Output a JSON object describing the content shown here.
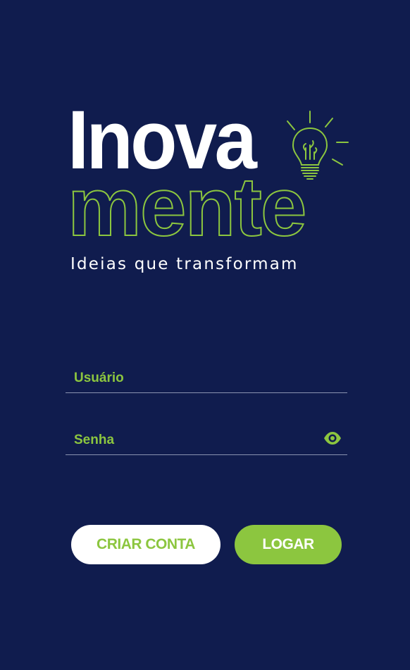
{
  "brand": {
    "word_top": "Inova",
    "word_bottom": "mente",
    "tagline": "Ideias que transformam",
    "colors": {
      "background": "#101c4e",
      "accent": "#8cc63f",
      "text": "#ffffff"
    }
  },
  "form": {
    "username": {
      "placeholder": "Usuário",
      "value": ""
    },
    "password": {
      "placeholder": "Senha",
      "value": "",
      "toggle_icon": "eye-icon"
    }
  },
  "actions": {
    "create_account_label": "CRIAR CONTA",
    "login_label": "LOGAR"
  }
}
